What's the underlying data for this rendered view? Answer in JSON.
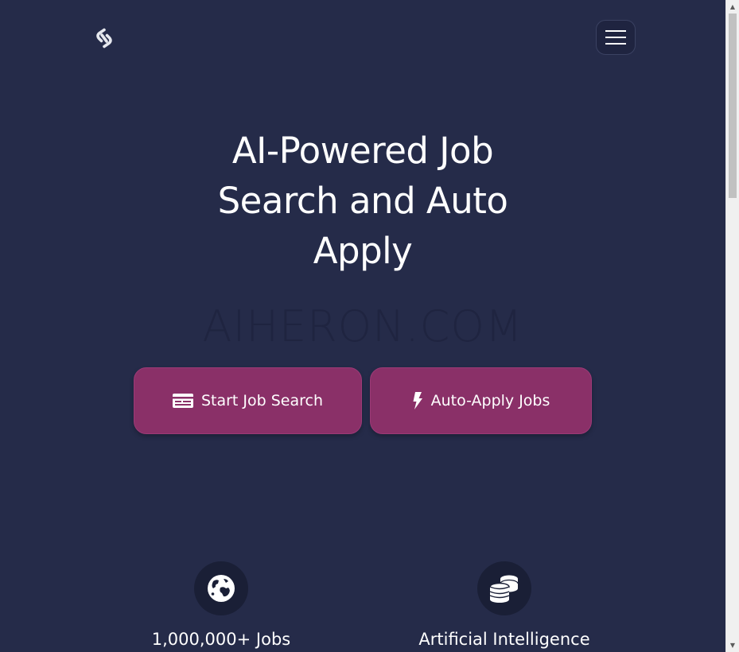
{
  "header": {
    "logo_icon": "link-logo-icon",
    "menu_icon": "hamburger-menu-icon"
  },
  "hero": {
    "title_line1": "AI-Powered Job",
    "title_line2": "Search and Auto",
    "title_line3": "Apply",
    "watermark": "AIHERON.COM"
  },
  "actions": {
    "start_search": {
      "label": "Start Job Search",
      "icon": "card-list-icon"
    },
    "auto_apply": {
      "label": "Auto-Apply Jobs",
      "icon": "lightning-bolt-icon"
    }
  },
  "features": [
    {
      "label": "1,000,000+ Jobs",
      "icon": "globe-icon"
    },
    {
      "label": "Artificial Intelligence",
      "icon": "coins-stack-icon"
    }
  ],
  "colors": {
    "background": "#252b49",
    "button": "#8a3068",
    "icon_circle": "#1a1f36",
    "text": "#ffffff"
  }
}
